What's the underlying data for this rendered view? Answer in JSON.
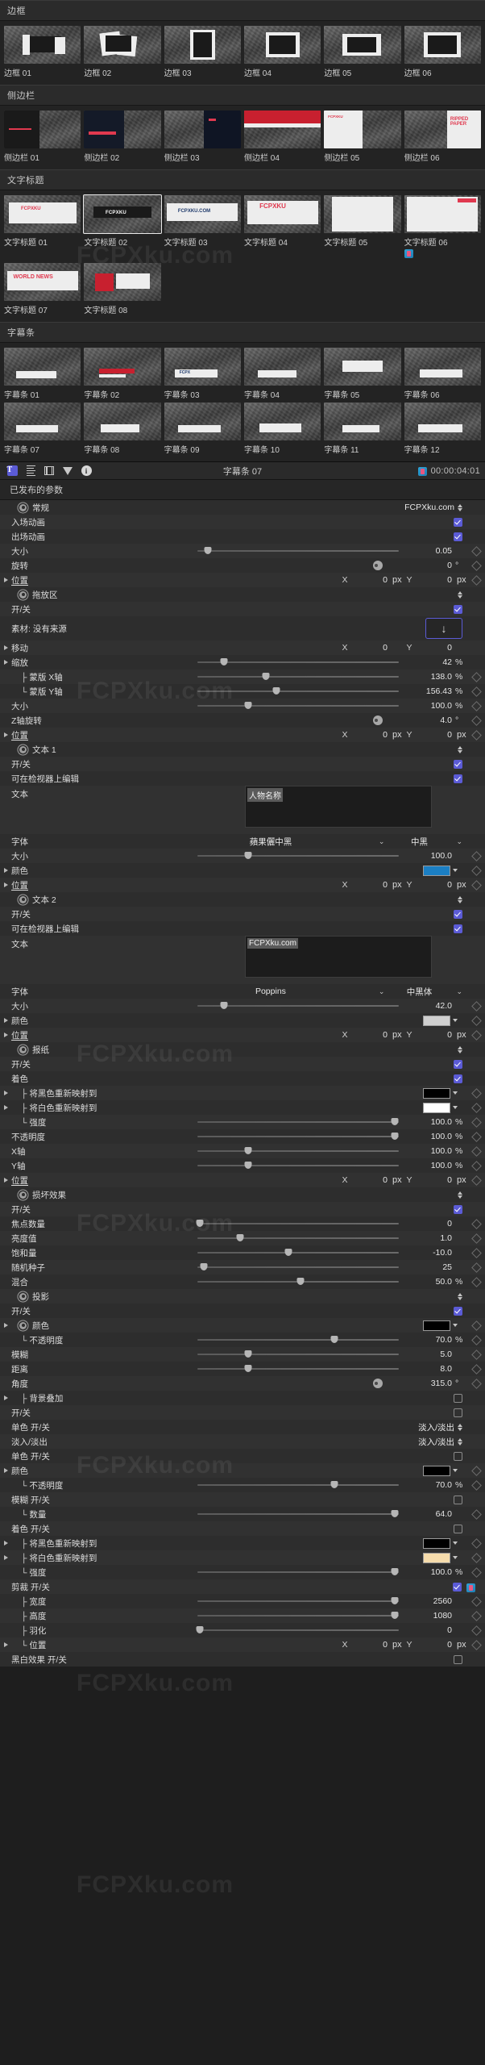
{
  "browser": {
    "categories": [
      {
        "title": "边框",
        "items": [
          {
            "label": "边框 01",
            "style": "b1"
          },
          {
            "label": "边框 02",
            "style": "b2"
          },
          {
            "label": "边框 03",
            "style": "b3"
          },
          {
            "label": "边框 04",
            "style": "b4"
          },
          {
            "label": "边框 05",
            "style": "b5"
          },
          {
            "label": "边框 06",
            "style": "b6"
          }
        ]
      },
      {
        "title": "侧边栏",
        "items": [
          {
            "label": "侧边栏 01",
            "style": "s1"
          },
          {
            "label": "侧边栏 02",
            "style": "s2"
          },
          {
            "label": "侧边栏 03",
            "style": "s3"
          },
          {
            "label": "侧边栏 04",
            "style": "s4"
          },
          {
            "label": "侧边栏 05",
            "style": "s5"
          },
          {
            "label": "侧边栏 06",
            "style": "s6"
          }
        ]
      },
      {
        "title": "文字标题",
        "items": [
          {
            "label": "文字标题 01",
            "style": "t1"
          },
          {
            "label": "文字标题 02",
            "style": "t2",
            "selected": true
          },
          {
            "label": "文字标题 03",
            "style": "t3"
          },
          {
            "label": "文字标题 04",
            "style": "t4"
          },
          {
            "label": "文字标题 05",
            "style": "t5"
          },
          {
            "label": "文字标题 06",
            "style": "t6",
            "badge": true
          },
          {
            "label": "文字标题 07",
            "style": "t7"
          },
          {
            "label": "文字标题 08",
            "style": "t8"
          }
        ]
      },
      {
        "title": "字幕条",
        "items": [
          {
            "label": "字幕条 01",
            "style": "l1"
          },
          {
            "label": "字幕条 02",
            "style": "l2"
          },
          {
            "label": "字幕条 03",
            "style": "l3"
          },
          {
            "label": "字幕条 04",
            "style": "l4"
          },
          {
            "label": "字幕条 05",
            "style": "l5"
          },
          {
            "label": "字幕条 06",
            "style": "l6"
          },
          {
            "label": "字幕条 07",
            "style": "l7"
          },
          {
            "label": "字幕条 08",
            "style": "l8"
          },
          {
            "label": "字幕条 09",
            "style": "l9"
          },
          {
            "label": "字幕条 10",
            "style": "l10"
          },
          {
            "label": "字幕条 11",
            "style": "l11"
          },
          {
            "label": "字幕条 12",
            "style": "l12"
          }
        ]
      }
    ]
  },
  "inspector": {
    "icons": [
      "text-icon",
      "text-lines-icon",
      "film-icon",
      "filter-icon",
      "info-icon"
    ],
    "title": "字幕条 07",
    "timecode": "00:00:04:01",
    "badge": "fcpx-icon",
    "section_title": "已发布的参数"
  },
  "params": [
    {
      "k": "group",
      "label": "常规",
      "value": "FCPXku.com",
      "kind": "popup"
    },
    {
      "label": "入场动画",
      "kind": "check",
      "checked": true
    },
    {
      "label": "出场动画",
      "kind": "check",
      "checked": true
    },
    {
      "label": "大小",
      "kind": "slider",
      "pos": 5,
      "value": "0.05",
      "unit": "",
      "kf": true
    },
    {
      "label": "旋转",
      "kind": "dial",
      "value": "0",
      "unit": "°",
      "kf": true
    },
    {
      "label": "位置",
      "kind": "xy",
      "disc": true,
      "x": "0",
      "xu": "px",
      "y": "0",
      "yu": "px",
      "kf": true,
      "under": true
    },
    {
      "k": "group",
      "label": "拖放区",
      "value": "",
      "kind": "stepper"
    },
    {
      "label": "开/关",
      "kind": "check",
      "checked": true
    },
    {
      "label": "素材: 没有来源",
      "kind": "drop",
      "button": "↓"
    },
    {
      "label": "移动",
      "kind": "xy",
      "disc": true,
      "x": "0",
      "xu": "",
      "y": "0",
      "yu": "",
      "kf": false
    },
    {
      "label": "缩放",
      "kind": "slider",
      "disc": true,
      "pos": 13,
      "value": "42",
      "unit": "%",
      "kf": false
    },
    {
      "label": "├ 蒙版 X轴",
      "kind": "slider",
      "ind": 1,
      "pos": 34,
      "value": "138.0",
      "unit": "%",
      "kf": true
    },
    {
      "label": "└ 蒙版 Y轴",
      "kind": "slider",
      "ind": 1,
      "pos": 39,
      "value": "156.43",
      "unit": "%",
      "kf": true
    },
    {
      "label": "大小",
      "kind": "slider",
      "pos": 25,
      "value": "100.0",
      "unit": "%",
      "kf": true
    },
    {
      "label": "Z轴旋转",
      "kind": "dial",
      "value": "4.0",
      "unit": "°",
      "kf": true
    },
    {
      "label": "位置",
      "kind": "xy",
      "disc": true,
      "x": "0",
      "xu": "px",
      "y": "0",
      "yu": "px",
      "kf": true,
      "under": true
    },
    {
      "k": "group",
      "label": "文本 1",
      "value": "",
      "kind": "stepper"
    },
    {
      "label": "开/关",
      "kind": "check",
      "checked": true
    },
    {
      "label": "可在检视器上编辑",
      "kind": "check",
      "checked": true
    },
    {
      "label": "文本",
      "kind": "textarea",
      "value": "人物名称"
    },
    {
      "label": "字体",
      "kind": "font",
      "font": "蘋果儷中黑",
      "style": "中黑"
    },
    {
      "label": "大小",
      "kind": "slider",
      "pos": 25,
      "value": "100.0",
      "unit": "",
      "kf": true
    },
    {
      "label": "颜色",
      "kind": "color",
      "disc": true,
      "color": "#1b7fc4",
      "kf": true
    },
    {
      "label": "位置",
      "kind": "xy",
      "disc": true,
      "x": "0",
      "xu": "px",
      "y": "0",
      "yu": "px",
      "kf": true,
      "under": true
    },
    {
      "k": "group",
      "label": "文本 2",
      "value": "",
      "kind": "stepper"
    },
    {
      "label": "开/关",
      "kind": "check",
      "checked": true
    },
    {
      "label": "可在检视器上编辑",
      "kind": "check",
      "checked": true
    },
    {
      "label": "文本",
      "kind": "textarea",
      "value": "FCPXku.com"
    },
    {
      "label": "字体",
      "kind": "font",
      "font": "Poppins",
      "style": "中黑体"
    },
    {
      "label": "大小",
      "kind": "slider",
      "pos": 13,
      "value": "42.0",
      "unit": "",
      "kf": true
    },
    {
      "label": "颜色",
      "kind": "color",
      "disc": true,
      "color": "#cfcfcf",
      "kf": true
    },
    {
      "label": "位置",
      "kind": "xy",
      "disc": true,
      "x": "0",
      "xu": "px",
      "y": "0",
      "yu": "px",
      "kf": true,
      "under": true
    },
    {
      "k": "group",
      "label": "报纸",
      "value": "",
      "kind": "stepper"
    },
    {
      "label": "开/关",
      "kind": "check",
      "checked": true
    },
    {
      "label": "着色",
      "kind": "check",
      "checked": true
    },
    {
      "label": "├ 将黑色重新映射到",
      "kind": "color",
      "disc": true,
      "ind": 1,
      "color": "#000000",
      "kf": true
    },
    {
      "label": "├ 将白色重新映射到",
      "kind": "color",
      "disc": true,
      "ind": 1,
      "color": "#ffffff",
      "kf": true
    },
    {
      "label": "└ 强度",
      "kind": "slider",
      "ind": 1,
      "pos": 98,
      "value": "100.0",
      "unit": "%",
      "kf": true
    },
    {
      "label": "不透明度",
      "kind": "slider",
      "pos": 98,
      "value": "100.0",
      "unit": "%",
      "kf": true
    },
    {
      "label": "X轴",
      "kind": "slider",
      "pos": 25,
      "value": "100.0",
      "unit": "%",
      "kf": true
    },
    {
      "label": "Y轴",
      "kind": "slider",
      "pos": 25,
      "value": "100.0",
      "unit": "%",
      "kf": true
    },
    {
      "label": "位置",
      "kind": "xy",
      "disc": true,
      "x": "0",
      "xu": "px",
      "y": "0",
      "yu": "px",
      "kf": true,
      "under": true
    },
    {
      "k": "group",
      "label": "损坏效果",
      "value": "",
      "kind": "stepper"
    },
    {
      "label": "开/关",
      "kind": "check",
      "checked": true
    },
    {
      "label": "焦点数量",
      "kind": "slider",
      "pos": 1,
      "value": "0",
      "unit": "",
      "kf": true
    },
    {
      "label": "亮度值",
      "kind": "slider",
      "pos": 21,
      "value": "1.0",
      "unit": "",
      "kf": true
    },
    {
      "label": "饱和量",
      "kind": "slider",
      "pos": 45,
      "value": "-10.0",
      "unit": "",
      "kf": true
    },
    {
      "label": "随机种子",
      "kind": "slider",
      "pos": 3,
      "value": "25",
      "unit": "",
      "kf": true
    },
    {
      "label": "混合",
      "kind": "slider",
      "pos": 51,
      "value": "50.0",
      "unit": "%",
      "kf": true
    },
    {
      "k": "group",
      "label": "投影",
      "value": "",
      "kind": "stepper"
    },
    {
      "label": "开/关",
      "kind": "check",
      "checked": true
    },
    {
      "k": "group",
      "label": "颜色",
      "value": "",
      "kind": "colorgroup",
      "disc": true,
      "color": "#000000",
      "kf": true
    },
    {
      "label": "└ 不透明度",
      "kind": "slider",
      "ind": 1,
      "pos": 68,
      "value": "70.0",
      "unit": "%",
      "kf": true
    },
    {
      "label": "模糊",
      "kind": "slider",
      "pos": 25,
      "value": "5.0",
      "unit": "",
      "kf": true
    },
    {
      "label": "距离",
      "kind": "slider",
      "pos": 25,
      "value": "8.0",
      "unit": "",
      "kf": true
    },
    {
      "label": "角度",
      "kind": "dial",
      "value": "315.0",
      "unit": "°",
      "kf": true
    },
    {
      "label": "├ 背景叠加",
      "kind": "check",
      "ind": 1,
      "checked": false,
      "disc": true
    },
    {
      "label": "开/关",
      "kind": "check",
      "checked": false
    },
    {
      "label": "单色 开/关",
      "kind": "popup",
      "value": "淡入/淡出"
    },
    {
      "label": "淡入/淡出",
      "kind": "popup",
      "value": "淡入/淡出"
    },
    {
      "label": "单色 开/关",
      "kind": "check",
      "checked": false
    },
    {
      "label": "颜色",
      "kind": "color",
      "disc": true,
      "color": "#000000",
      "kf": true
    },
    {
      "label": "└ 不透明度",
      "kind": "slider",
      "ind": 1,
      "pos": 68,
      "value": "70.0",
      "unit": "%",
      "kf": true
    },
    {
      "label": "模糊 开/关",
      "kind": "check",
      "checked": false
    },
    {
      "label": "└ 数量",
      "kind": "slider",
      "ind": 1,
      "pos": 98,
      "value": "64.0",
      "unit": "",
      "kf": true
    },
    {
      "label": "着色 开/关",
      "kind": "check",
      "checked": false
    },
    {
      "label": "├ 将黑色重新映射到",
      "kind": "color",
      "disc": true,
      "ind": 1,
      "color": "#000000",
      "kf": true
    },
    {
      "label": "├ 将白色重新映射到",
      "kind": "color",
      "disc": true,
      "ind": 1,
      "color": "#f6dcac",
      "kf": true
    },
    {
      "label": "└ 强度",
      "kind": "slider",
      "ind": 1,
      "pos": 98,
      "value": "100.0",
      "unit": "%",
      "kf": true
    },
    {
      "label": "剪裁 开/关",
      "kind": "check",
      "checked": true,
      "badge": true
    },
    {
      "label": "├ 宽度",
      "kind": "slider",
      "ind": 1,
      "pos": 98,
      "value": "2560",
      "unit": "",
      "kf": true
    },
    {
      "label": "├ 高度",
      "kind": "slider",
      "ind": 1,
      "pos": 98,
      "value": "1080",
      "unit": "",
      "kf": true
    },
    {
      "label": "├ 羽化",
      "kind": "slider",
      "ind": 1,
      "pos": 1,
      "value": "0",
      "unit": "",
      "kf": true
    },
    {
      "label": "└ 位置",
      "kind": "xy",
      "disc": true,
      "ind": 1,
      "x": "0",
      "xu": "px",
      "y": "0",
      "yu": "px",
      "kf": true
    },
    {
      "label": "黑白效果 开/关",
      "kind": "check",
      "checked": false
    }
  ],
  "watermark": "FCPXku.com"
}
